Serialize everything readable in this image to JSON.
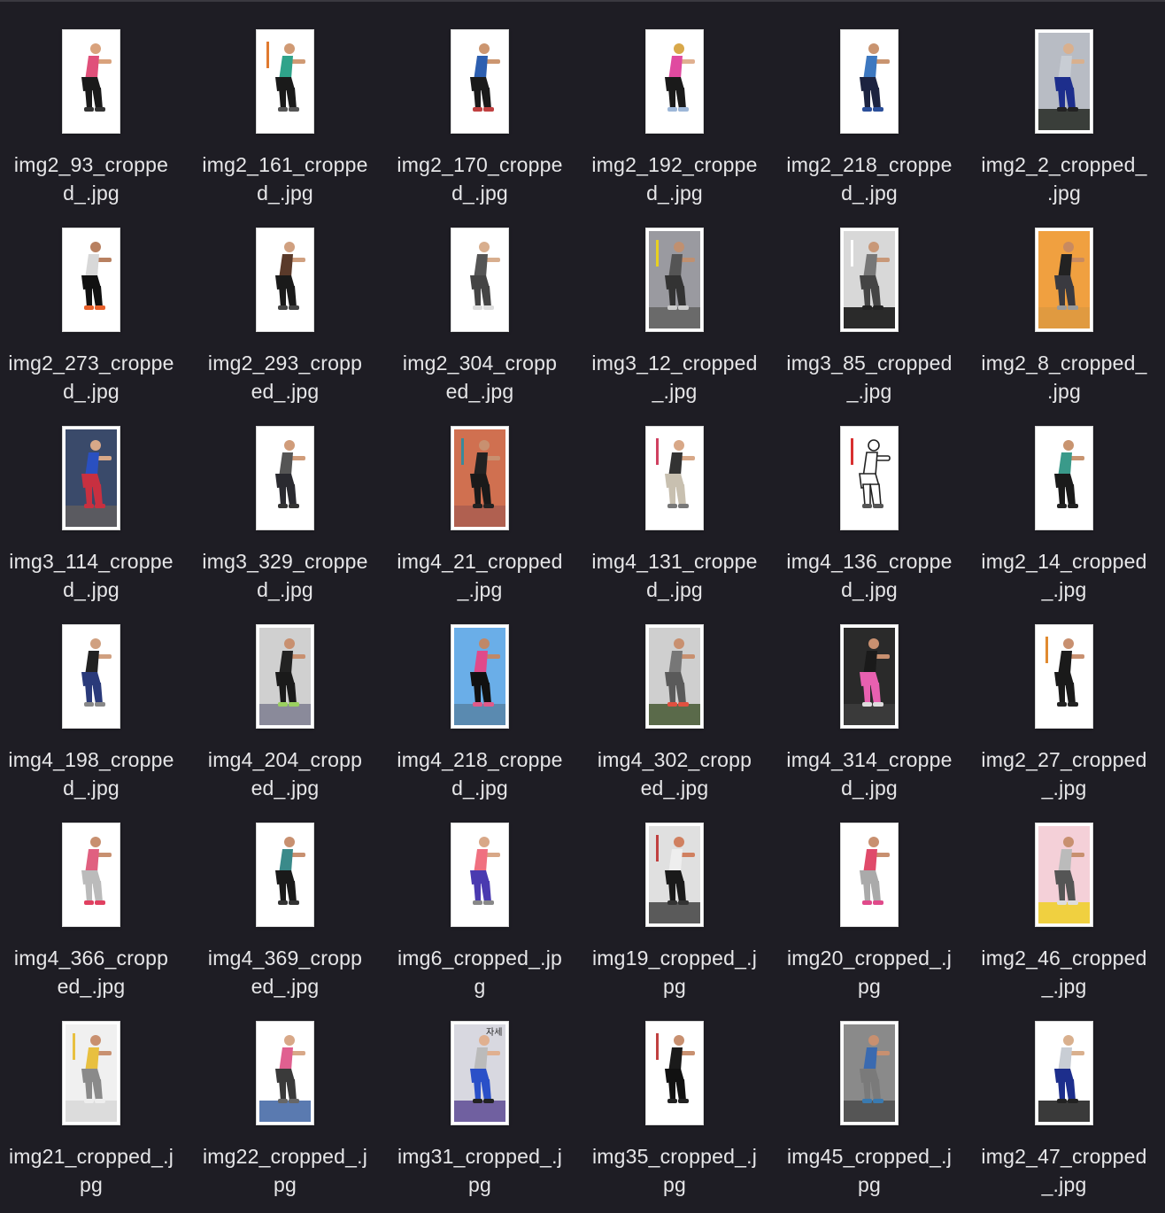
{
  "files": [
    {
      "line1": "img2_93_croppe",
      "line2": "d_.jpg",
      "thumb": {
        "bg": "#ffffff",
        "floor": "#ffffff",
        "top": "#e0507a",
        "bottom": "#1a1a1a",
        "shoe": "#333333",
        "skin": "#d9a27c"
      }
    },
    {
      "line1": "img2_161_croppe",
      "line2": "d_.jpg",
      "thumb": {
        "bg": "#ffffff",
        "floor": "#ffffff",
        "top": "#2fa38a",
        "bottom": "#1a1a1a",
        "shoe": "#555555",
        "skin": "#d09a74",
        "accent": "#e07a30"
      }
    },
    {
      "line1": "img2_170_croppe",
      "line2": "d_.jpg",
      "thumb": {
        "bg": "#ffffff",
        "floor": "#ffffff",
        "top": "#2d5fb0",
        "bottom": "#1a1a1a",
        "shoe": "#c04040",
        "skin": "#cc9670"
      }
    },
    {
      "line1": "img2_192_croppe",
      "line2": "d_.jpg",
      "thumb": {
        "bg": "#ffffff",
        "floor": "#ffffff",
        "top": "#e04aa0",
        "bottom": "#1a1a1a",
        "shoe": "#9db7d8",
        "skin": "#e0b090",
        "hair": "#d8a84a"
      }
    },
    {
      "line1": "img2_218_croppe",
      "line2": "d_.jpg",
      "thumb": {
        "bg": "#ffffff",
        "floor": "#ffffff",
        "top": "#3d78c0",
        "bottom": "#1c2340",
        "shoe": "#2b4f9a",
        "skin": "#c99470"
      }
    },
    {
      "line1": "img2_2_cropped_",
      "line2": ".jpg",
      "thumb": {
        "bg": "#b8bcc4",
        "floor": "#3a3e3a",
        "top": "#c8cdd4",
        "bottom": "#1d2e8c",
        "shoe": "#222222",
        "skin": "#d9b08e"
      }
    },
    {
      "line1": "img2_273_croppe",
      "line2": "d_.jpg",
      "thumb": {
        "bg": "#ffffff",
        "floor": "#ffffff",
        "top": "#d8d8d8",
        "bottom": "#111111",
        "shoe": "#e8602a",
        "skin": "#b88060"
      }
    },
    {
      "line1": "img2_293_cropp",
      "line2": "ed_.jpg",
      "thumb": {
        "bg": "#ffffff",
        "floor": "#ffffff",
        "top": "#5a3a2a",
        "bottom": "#1a1a1a",
        "shoe": "#444444",
        "skin": "#d0a080"
      }
    },
    {
      "line1": "img2_304_cropp",
      "line2": "ed_.jpg",
      "thumb": {
        "bg": "#ffffff",
        "floor": "#ffffff",
        "top": "#555555",
        "bottom": "#444444",
        "shoe": "#dddddd",
        "skin": "#d8ae8e"
      }
    },
    {
      "line1": "img3_12_cropped",
      "line2": "_.jpg",
      "thumb": {
        "bg": "#9a9aa0",
        "floor": "#6a6a6a",
        "top": "#555555",
        "bottom": "#333333",
        "shoe": "#cccccc",
        "skin": "#c09070",
        "accent": "#e8d020"
      }
    },
    {
      "line1": "img3_85_cropped",
      "line2": "_.jpg",
      "thumb": {
        "bg": "#d8d8d8",
        "floor": "#2a2a2a",
        "top": "#777777",
        "bottom": "#444444",
        "shoe": "#222222",
        "skin": "#c89878",
        "accent": "#ffffff"
      }
    },
    {
      "line1": "img2_8_cropped_",
      "line2": ".jpg",
      "thumb": {
        "bg": "#f0a040",
        "floor": "#e09a40",
        "top": "#222222",
        "bottom": "#3a3a40",
        "shoe": "#999999",
        "skin": "#c88a60"
      }
    },
    {
      "line1": "img3_114_croppe",
      "line2": "d_.jpg",
      "thumb": {
        "bg": "#3a4a6a",
        "floor": "#5a5a60",
        "top": "#2a50c0",
        "bottom": "#c83040",
        "shoe": "#c83040",
        "skin": "#d8a888"
      }
    },
    {
      "line1": "img3_329_croppe",
      "line2": "d_.jpg",
      "thumb": {
        "bg": "#ffffff",
        "floor": "#ffffff",
        "top": "#555555",
        "bottom": "#2a2a30",
        "shoe": "#333333",
        "skin": "#d09c7a"
      }
    },
    {
      "line1": "img4_21_cropped",
      "line2": "_.jpg",
      "thumb": {
        "bg": "#d07050",
        "floor": "#b06050",
        "top": "#222222",
        "bottom": "#1a1a1a",
        "shoe": "#222222",
        "skin": "#c89070",
        "accent": "#3a8a9a"
      }
    },
    {
      "line1": "img4_131_croppe",
      "line2": "d_.jpg",
      "thumb": {
        "bg": "#ffffff",
        "floor": "#ffffff",
        "top": "#333333",
        "bottom": "#c8c0b0",
        "shoe": "#777777",
        "skin": "#d8a888",
        "accent": "#d04060"
      }
    },
    {
      "line1": "img4_136_croppe",
      "line2": "d_.jpg",
      "thumb": {
        "bg": "#ffffff",
        "floor": "#ffffff",
        "top": "#ffffff",
        "bottom": "#ffffff",
        "shoe": "#555555",
        "skin": "#ffffff",
        "accent": "#d83030",
        "outline": true
      }
    },
    {
      "line1": "img2_14_cropped",
      "line2": "_.jpg",
      "thumb": {
        "bg": "#ffffff",
        "floor": "#ffffff",
        "top": "#3a9a8a",
        "bottom": "#1a1a1a",
        "shoe": "#222222",
        "skin": "#c89470"
      }
    },
    {
      "line1": "img4_198_croppe",
      "line2": "d_.jpg",
      "thumb": {
        "bg": "#ffffff",
        "floor": "#ffffff",
        "top": "#222222",
        "bottom": "#2a3a7a",
        "shoe": "#888888",
        "skin": "#d0a080"
      }
    },
    {
      "line1": "img4_204_cropp",
      "line2": "ed_.jpg",
      "thumb": {
        "bg": "#d0d0d0",
        "floor": "#8a8a9a",
        "top": "#222222",
        "bottom": "#1a1a1a",
        "shoe": "#9ad060",
        "skin": "#c89070"
      }
    },
    {
      "line1": "img4_218_croppe",
      "line2": "d_.jpg",
      "thumb": {
        "bg": "#6aaee8",
        "floor": "#5a8ab0",
        "top": "#e04a8a",
        "bottom": "#111111",
        "shoe": "#e05a8a",
        "skin": "#c08868"
      }
    },
    {
      "line1": "img4_302_cropp",
      "line2": "ed_.jpg",
      "thumb": {
        "bg": "#cfcfcf",
        "floor": "#5a6a4a",
        "top": "#777777",
        "bottom": "#5a5a5a",
        "shoe": "#e05040",
        "skin": "#c89070"
      }
    },
    {
      "line1": "img4_314_croppe",
      "line2": "d_.jpg",
      "thumb": {
        "bg": "#2a2a2a",
        "floor": "#3a3a3a",
        "top": "#1a1a1a",
        "bottom": "#e860b0",
        "shoe": "#dddddd",
        "skin": "#c89070"
      }
    },
    {
      "line1": "img2_27_cropped",
      "line2": "_.jpg",
      "thumb": {
        "bg": "#ffffff",
        "floor": "#ffffff",
        "top": "#1a1a1a",
        "bottom": "#1a1a1a",
        "shoe": "#222222",
        "skin": "#c89070",
        "accent": "#e08a30"
      }
    },
    {
      "line1": "img4_366_cropp",
      "line2": "ed_.jpg",
      "thumb": {
        "bg": "#ffffff",
        "floor": "#ffffff",
        "top": "#e06080",
        "bottom": "#bbbbbb",
        "shoe": "#e04060",
        "skin": "#c89070"
      }
    },
    {
      "line1": "img4_369_cropp",
      "line2": "ed_.jpg",
      "thumb": {
        "bg": "#ffffff",
        "floor": "#ffffff",
        "top": "#3a8a8a",
        "bottom": "#1a1a1a",
        "shoe": "#333333",
        "skin": "#c89070"
      }
    },
    {
      "line1": "img6_cropped_.jp",
      "line2": "g",
      "thumb": {
        "bg": "#ffffff",
        "floor": "#ffffff",
        "top": "#f07080",
        "bottom": "#4a3ab0",
        "shoe": "#888888",
        "skin": "#d8a888"
      }
    },
    {
      "line1": "img19_cropped_.j",
      "line2": "pg",
      "thumb": {
        "bg": "#e0e0e0",
        "floor": "#5a5a5a",
        "top": "#eeeeee",
        "bottom": "#1a1a1a",
        "shoe": "#333333",
        "skin": "#d08060",
        "accent": "#c04040"
      }
    },
    {
      "line1": "img20_cropped_.j",
      "line2": "pg",
      "thumb": {
        "bg": "#ffffff",
        "floor": "#ffffff",
        "top": "#e04a6a",
        "bottom": "#aaaaaa",
        "shoe": "#e04a8a",
        "skin": "#c89070"
      }
    },
    {
      "line1": "img2_46_cropped",
      "line2": "_.jpg",
      "thumb": {
        "bg": "#f4d0d8",
        "floor": "#f0d040",
        "top": "#bbbbbb",
        "bottom": "#555555",
        "shoe": "#dddddd",
        "skin": "#c89070"
      }
    },
    {
      "line1": "img21_cropped_.j",
      "line2": "pg",
      "thumb": {
        "bg": "#f0f0f0",
        "floor": "#dcdcdc",
        "top": "#e8c040",
        "bottom": "#8a8a8a",
        "shoe": "#eeeeee",
        "skin": "#c89070",
        "accent": "#e8c040"
      }
    },
    {
      "line1": "img22_cropped_.j",
      "line2": "pg",
      "thumb": {
        "bg": "#ffffff",
        "floor": "#5a7ab0",
        "top": "#e06090",
        "bottom": "#3a3a3a",
        "shoe": "#666666",
        "skin": "#d8a888"
      }
    },
    {
      "line1": "img31_cropped_.j",
      "line2": "pg",
      "thumb": {
        "bg": "#d8d8e0",
        "floor": "#7060a0",
        "top": "#bbbbbb",
        "bottom": "#2a50c8",
        "shoe": "#222222",
        "skin": "#e0b090",
        "text": "자세"
      }
    },
    {
      "line1": "img35_cropped_.j",
      "line2": "pg",
      "thumb": {
        "bg": "#ffffff",
        "floor": "#ffffff",
        "top": "#1a1a1a",
        "bottom": "#111111",
        "shoe": "#222222",
        "skin": "#c89070",
        "accent": "#c04040"
      }
    },
    {
      "line1": "img45_cropped_.j",
      "line2": "pg",
      "thumb": {
        "bg": "#8a8a8a",
        "floor": "#555555",
        "top": "#3a6ab0",
        "bottom": "#7a7a7a",
        "shoe": "#3a7ab0",
        "skin": "#c89070"
      }
    },
    {
      "line1": "img2_47_cropped",
      "line2": "_.jpg",
      "thumb": {
        "bg": "#ffffff",
        "floor": "#3a3a3a",
        "top": "#c8cdd4",
        "bottom": "#1d2e8c",
        "shoe": "#222222",
        "skin": "#d9b08e"
      }
    }
  ]
}
